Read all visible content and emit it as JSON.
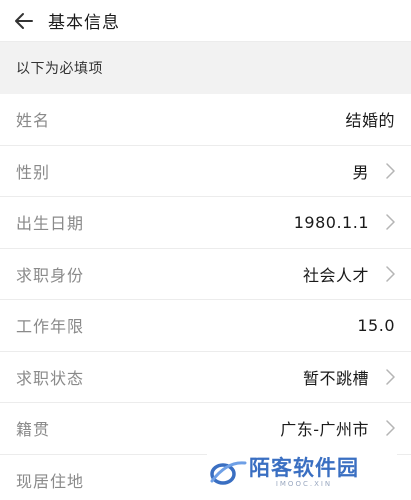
{
  "header": {
    "title": "基本信息",
    "back_icon": "arrow-left-icon"
  },
  "section": {
    "title": "以下为必填项"
  },
  "fields": [
    {
      "label": "姓名",
      "value": "结婚的",
      "has_chevron": false
    },
    {
      "label": "性别",
      "value": "男",
      "has_chevron": true
    },
    {
      "label": "出生日期",
      "value": "1980.1.1",
      "has_chevron": true
    },
    {
      "label": "求职身份",
      "value": "社会人才",
      "has_chevron": true
    },
    {
      "label": "工作年限",
      "value": "15.0",
      "has_chevron": false
    },
    {
      "label": "求职状态",
      "value": "暂不跳槽",
      "has_chevron": true
    },
    {
      "label": "籍贯",
      "value": "广东-广州市",
      "has_chevron": true
    },
    {
      "label": "现居住地",
      "value": "",
      "has_chevron": false
    }
  ],
  "watermark": {
    "text": "陌客软件园",
    "subtext": "IMOOC.XIN"
  },
  "colors": {
    "label": "#8a8a8a",
    "value": "#1a1a1a",
    "section_bg": "#f2f2f2",
    "divider": "#ececec",
    "watermark": "#3a6fc2"
  }
}
